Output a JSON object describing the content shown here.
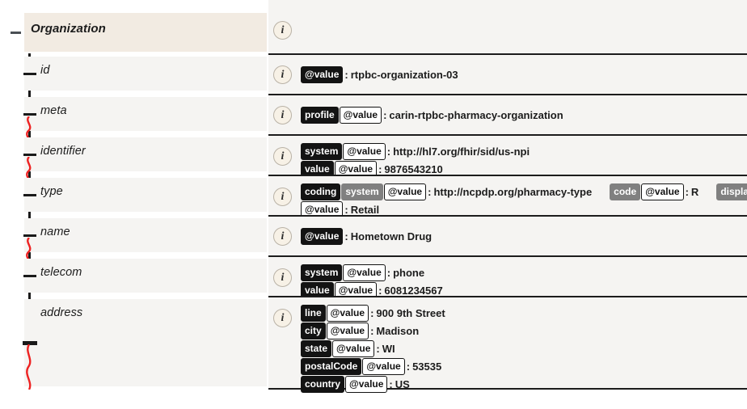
{
  "resource": {
    "name": "Organization",
    "toggle_state": "expanded",
    "toggle_icon": "minus-icon",
    "info_icon": "info-icon"
  },
  "fields": [
    {
      "name": "id",
      "repeating": false,
      "lines": [
        {
          "tags": [
            {
              "text": "@value",
              "style": "black"
            }
          ],
          "value": "rtpbc-organization-03"
        }
      ]
    },
    {
      "name": "meta",
      "repeating": true,
      "lines": [
        {
          "tags": [
            {
              "text": "profile",
              "style": "black"
            },
            {
              "text": "@value",
              "style": "open"
            }
          ],
          "value": "carin-rtpbc-pharmacy-organization"
        }
      ]
    },
    {
      "name": "identifier",
      "repeating": true,
      "lines": [
        {
          "tags": [
            {
              "text": "system",
              "style": "black"
            },
            {
              "text": "@value",
              "style": "open"
            }
          ],
          "value": "http://hl7.org/fhir/sid/us-npi"
        },
        {
          "tags": [
            {
              "text": "value",
              "style": "black"
            },
            {
              "text": "@value",
              "style": "open"
            }
          ],
          "value": "9876543210"
        }
      ]
    },
    {
      "name": "type",
      "repeating": false,
      "lines": [
        {
          "tags": [
            {
              "text": "coding",
              "style": "black"
            },
            {
              "text": "system",
              "style": "gray"
            },
            {
              "text": "@value",
              "style": "open"
            }
          ],
          "value": "http://ncpdp.org/pharmacy-type",
          "extra": [
            {
              "tags": [
                {
                  "text": "code",
                  "style": "gray"
                },
                {
                  "text": "@value",
                  "style": "open"
                }
              ],
              "value": "R"
            },
            {
              "tags": [
                {
                  "text": "display",
                  "style": "gray"
                }
              ],
              "value": ""
            }
          ]
        },
        {
          "tags": [
            {
              "text": "@value",
              "style": "open"
            }
          ],
          "value": "Retail"
        }
      ]
    },
    {
      "name": "name",
      "repeating": true,
      "lines": [
        {
          "tags": [
            {
              "text": "@value",
              "style": "black"
            }
          ],
          "value": "Hometown Drug"
        }
      ]
    },
    {
      "name": "telecom",
      "repeating": false,
      "lines": [
        {
          "tags": [
            {
              "text": "system",
              "style": "black"
            },
            {
              "text": "@value",
              "style": "open"
            }
          ],
          "value": "phone"
        },
        {
          "tags": [
            {
              "text": "value",
              "style": "black"
            },
            {
              "text": "@value",
              "style": "open"
            }
          ],
          "value": "6081234567"
        }
      ]
    },
    {
      "name": "address",
      "repeating": true,
      "lines": [
        {
          "tags": [
            {
              "text": "line",
              "style": "black"
            },
            {
              "text": "@value",
              "style": "open"
            }
          ],
          "value": "900 9th Street"
        },
        {
          "tags": [
            {
              "text": "city",
              "style": "black"
            },
            {
              "text": "@value",
              "style": "open"
            }
          ],
          "value": "Madison"
        },
        {
          "tags": [
            {
              "text": "state",
              "style": "black"
            },
            {
              "text": "@value",
              "style": "open"
            }
          ],
          "value": "WI"
        },
        {
          "tags": [
            {
              "text": "postalCode",
              "style": "black"
            },
            {
              "text": "@value",
              "style": "open"
            }
          ],
          "value": "53535"
        },
        {
          "tags": [
            {
              "text": "country",
              "style": "black"
            },
            {
              "text": "@value",
              "style": "open"
            }
          ],
          "value": "US"
        }
      ]
    }
  ],
  "colors": {
    "header_background": "#f2ebe2",
    "row_background": "#f5f4f2",
    "repeat_marker": "#ee2222",
    "tag_black": "#131313",
    "tag_gray": "#808080",
    "separator": "#1c1c1c"
  }
}
